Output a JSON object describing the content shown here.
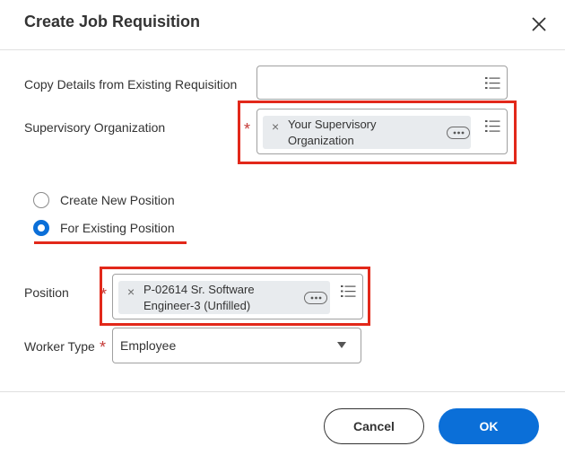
{
  "dialog": {
    "title": "Create Job Requisition"
  },
  "fields": {
    "copy_details": {
      "label": "Copy Details from Existing Requisition",
      "value": ""
    },
    "supervisory_org": {
      "label": "Supervisory Organization",
      "required_mark": "*",
      "chip_line1": "Your Supervisory",
      "chip_line2": "Organization",
      "remove_glyph": "×"
    },
    "position_choice": {
      "options": [
        {
          "label": "Create New Position",
          "selected": false
        },
        {
          "label": "For Existing Position",
          "selected": true
        }
      ]
    },
    "position": {
      "label": "Position",
      "required_mark": "*",
      "chip_line1": "P-02614 Sr. Software",
      "chip_line2": "Engineer-3 (Unfilled)",
      "remove_glyph": "×"
    },
    "worker_type": {
      "label": "Worker Type",
      "required_mark": "*",
      "value": "Employee"
    }
  },
  "footer": {
    "cancel_label": "Cancel",
    "ok_label": "OK"
  },
  "colors": {
    "primary": "#0b6fd8",
    "required": "#c53a37",
    "annotation": "#e2281a"
  },
  "icons": [
    "close-icon",
    "list-icon",
    "more-options-icon",
    "remove-icon",
    "dropdown-caret-icon"
  ]
}
